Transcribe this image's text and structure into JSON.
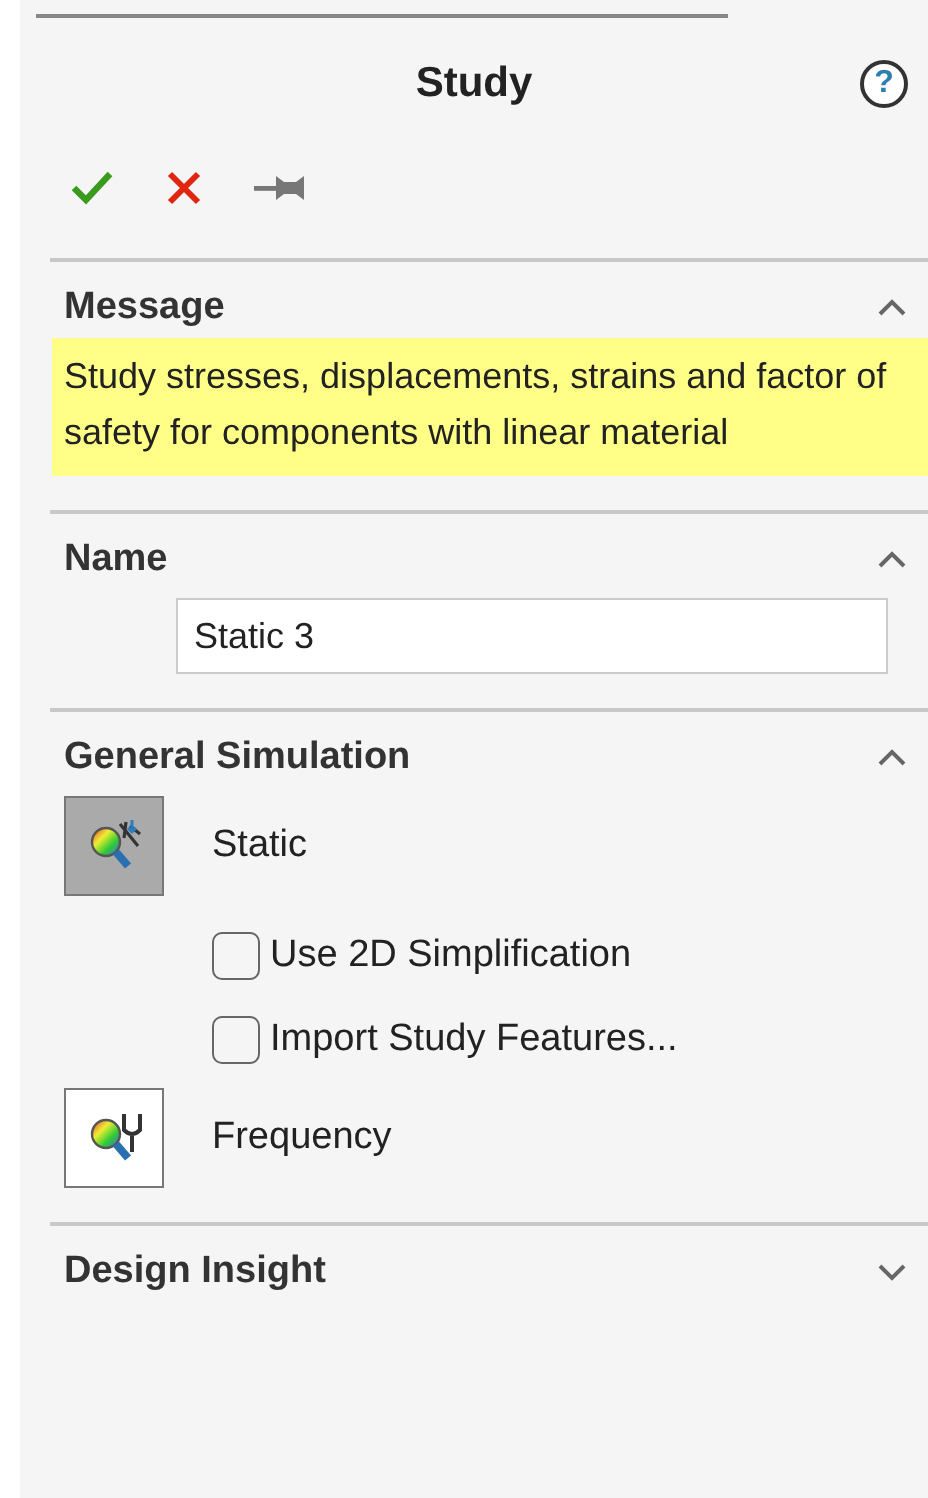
{
  "panel": {
    "title": "Study",
    "help_label": "?"
  },
  "message": {
    "title": "Message",
    "expanded": true,
    "text": "Study stresses, displacements, strains and factor of safety  for components with linear material"
  },
  "name": {
    "title": "Name",
    "expanded": true,
    "value": "Static 3"
  },
  "general_simulation": {
    "title": "General Simulation",
    "expanded": true,
    "study_types": [
      {
        "kind": "static",
        "label": "Static",
        "selected": true,
        "options": [
          {
            "label": "Use 2D Simplification",
            "checked": false
          },
          {
            "label": "Import Study Features...",
            "checked": false
          }
        ]
      },
      {
        "kind": "frequency",
        "label": "Frequency",
        "selected": false
      }
    ]
  },
  "design_insight": {
    "title": "Design Insight",
    "expanded": false
  }
}
